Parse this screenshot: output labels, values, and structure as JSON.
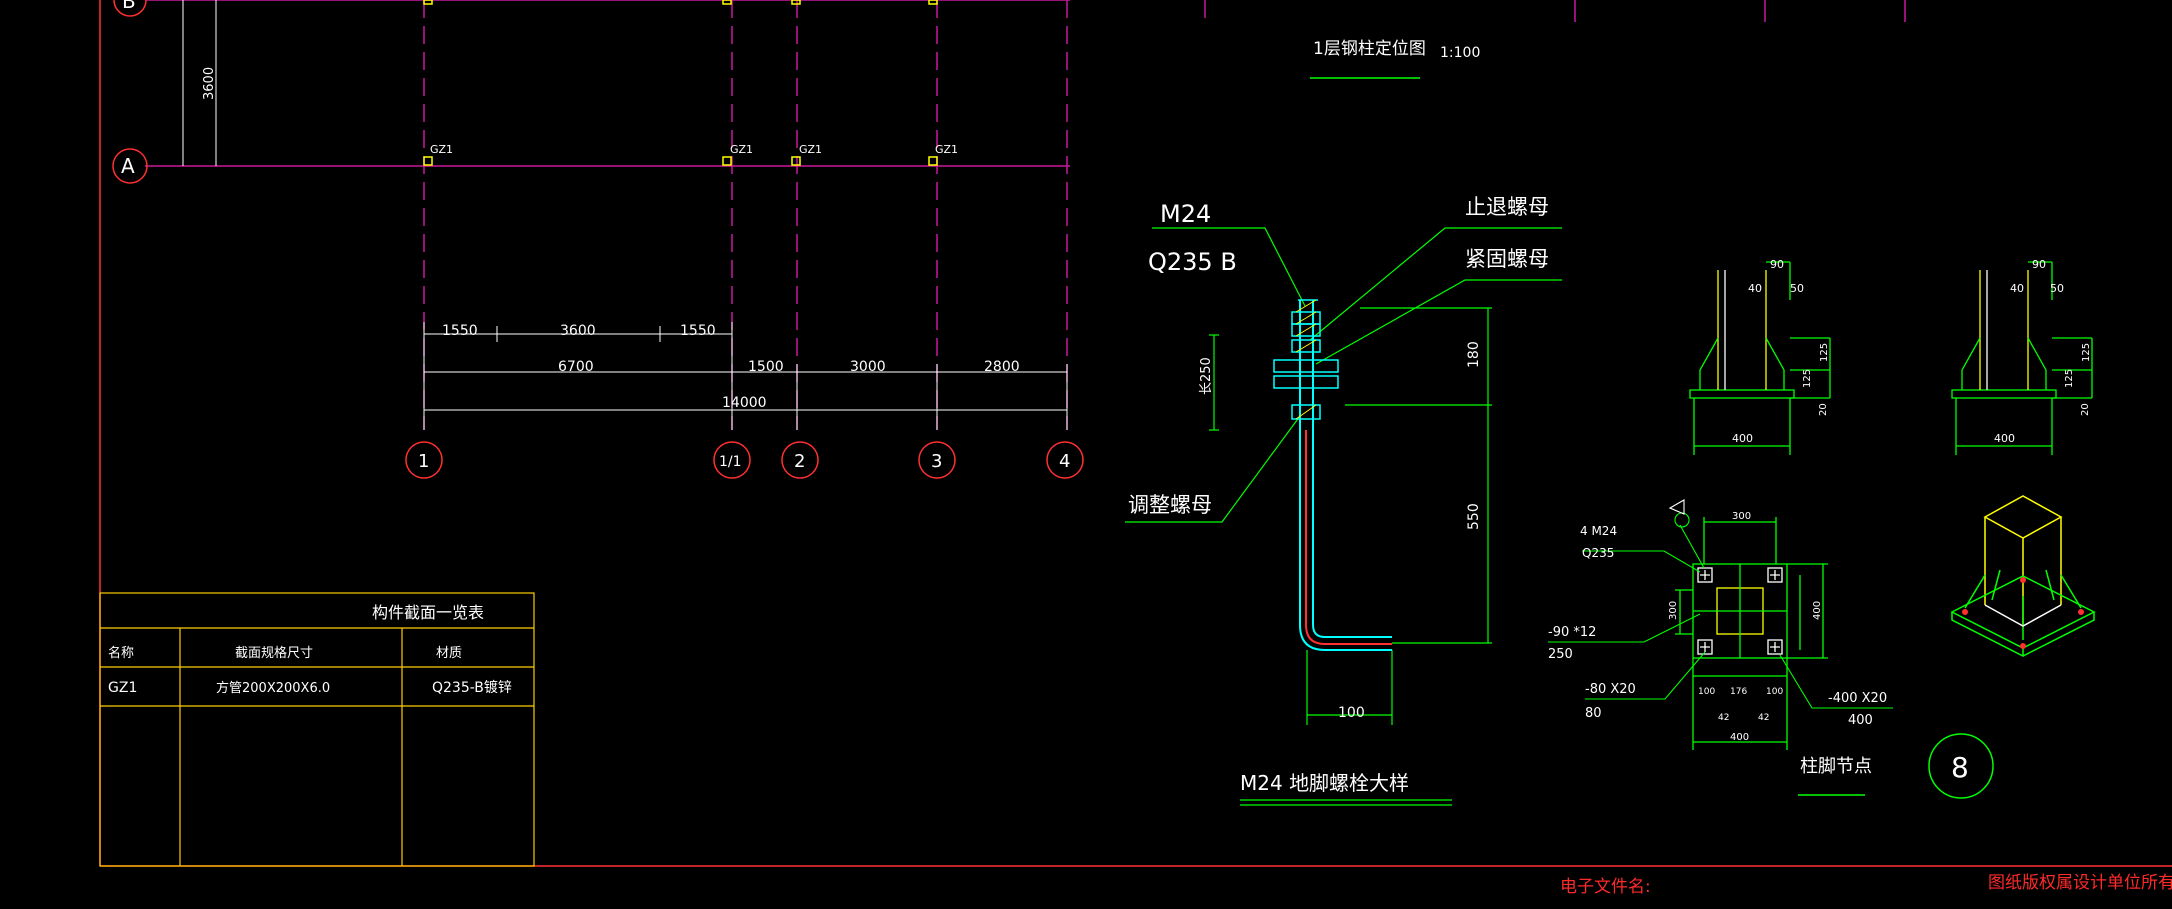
{
  "plan": {
    "axis_rows": [
      "B",
      "A"
    ],
    "axis_cols": [
      "1",
      "1/1",
      "2",
      "3",
      "4"
    ],
    "column_tag": "GZ1",
    "dims": {
      "row_spacing": "3600",
      "top_1": "1550",
      "top_2": "3600",
      "top_3": "1550",
      "mid_1": "6700",
      "mid_2": "1500",
      "mid_3": "3000",
      "mid_4": "2800",
      "total": "14000"
    },
    "title": "1层钢柱定位图",
    "scale": "1:100"
  },
  "table": {
    "title": "构件截面一览表",
    "headers": [
      "名称",
      "截面规格尺寸",
      "材质"
    ],
    "rows": [
      [
        "GZ1",
        "方管200X200X6.0",
        "Q235-B镀锌"
      ]
    ]
  },
  "bolt_detail": {
    "m24": "M24",
    "q235b": "Q235 B",
    "stop_nut": "止退螺母",
    "lock_nut": "紧固螺母",
    "adjust_nut": "调整螺母",
    "len_label": "长250",
    "dim_180": "180",
    "dim_550": "550",
    "dim_100": "100",
    "title": "M24 地脚螺栓大样"
  },
  "base_detail": {
    "elev1": {
      "d90": "90",
      "d40": "40",
      "d50": "50",
      "d125a": "125",
      "d125b": "125",
      "d20": "20",
      "d400": "400"
    },
    "elev2": {
      "d90": "90",
      "d40": "40",
      "d50": "50",
      "d125a": "125",
      "d125b": "125",
      "d20": "20",
      "d400": "400"
    },
    "bolts": "4 M24",
    "bolts_mat": "Q235",
    "stiff1": "-90 *12",
    "stiff1_len": "250",
    "stiff2": "-80 X20",
    "stiff2_len": "80",
    "plate": "-400 X20",
    "plate_len": "400",
    "d300_top": "300",
    "d300_left": "300",
    "d400_right": "400",
    "d400_bottom": "400",
    "d_100a": "100",
    "d_176": "176",
    "d_100b": "100",
    "d_42a": "42",
    "d_42b": "42",
    "title": "柱脚节点",
    "number": "8"
  },
  "footer": {
    "file_label": "电子文件名:",
    "copyright": "图纸版权属设计单位所有,未经"
  },
  "colors": {
    "background": "#000000",
    "axis_magenta": "#c8189c",
    "dimension": "#ffffff",
    "bubble": "#ff3030",
    "table": "#ffcc00",
    "leader": "#00ff00",
    "bolt": "#00ffff",
    "footer_red": "#ff2020"
  }
}
